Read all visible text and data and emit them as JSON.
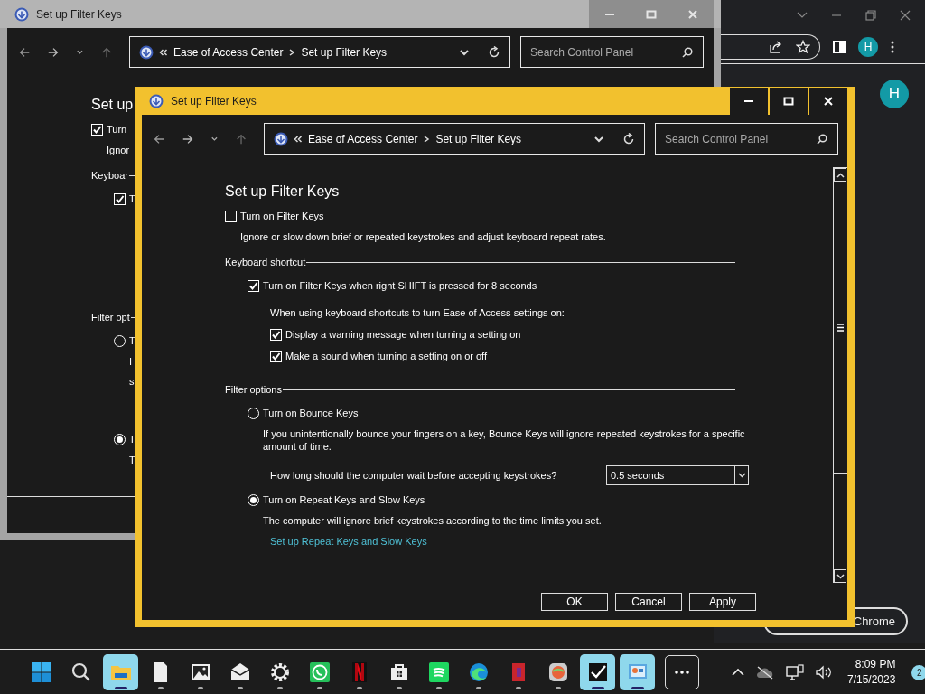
{
  "chrome_window": {
    "profile_initial": "H",
    "account_initial": "H",
    "open_button": "Chrome"
  },
  "back_window": {
    "title": "Set up Filter Keys",
    "breadcrumb": [
      "Ease of Access Center",
      "Set up Filter Keys"
    ],
    "search": {
      "placeholder": "Search Control Panel"
    },
    "content": [
      {
        "kind": "heading",
        "text": "Set up"
      },
      {
        "kind": "checkbox",
        "text": "Turn",
        "checked": true,
        "children": [
          {
            "kind": "description",
            "text": "Ignor"
          }
        ]
      },
      {
        "kind": "group",
        "text": "Keyboar",
        "children": [
          {
            "kind": "checkbox",
            "text": "T",
            "checked": true
          }
        ]
      },
      {
        "kind": "group",
        "text": "Filter opt",
        "children": [
          {
            "kind": "radio",
            "text": "T",
            "selected": false,
            "children": [
              {
                "kind": "description",
                "text": "I"
              },
              {
                "kind": "description",
                "text": "s"
              }
            ]
          },
          {
            "kind": "radio",
            "text": "T",
            "selected": true,
            "children": [
              {
                "kind": "description",
                "text": "T"
              }
            ]
          }
        ]
      }
    ]
  },
  "dialog": {
    "title": "Set up Filter Keys",
    "breadcrumb": [
      "Ease of Access Center",
      "Set up Filter Keys"
    ],
    "search": {
      "placeholder": "Search Control Panel"
    },
    "content": [
      {
        "kind": "heading",
        "text": "Set up Filter Keys"
      },
      {
        "kind": "checkbox",
        "text": "Turn on Filter Keys",
        "checked": false,
        "children": [
          {
            "kind": "description",
            "text": "Ignore or slow down brief or repeated keystrokes and adjust keyboard repeat rates."
          }
        ]
      },
      {
        "kind": "group",
        "text": "Keyboard shortcut",
        "children": [
          {
            "kind": "checkbox",
            "text": "Turn on Filter Keys when right SHIFT is pressed for 8 seconds",
            "checked": true,
            "children": [
              {
                "kind": "text",
                "text": "When using keyboard shortcuts to turn Ease of Access settings on:"
              },
              {
                "kind": "checkbox",
                "text": "Display a warning message when turning a setting on",
                "checked": true
              },
              {
                "kind": "checkbox",
                "text": "Make a sound when turning a setting on or off",
                "checked": true
              }
            ]
          }
        ]
      },
      {
        "kind": "group",
        "text": "Filter options",
        "children": [
          {
            "kind": "radio",
            "text": "Turn on Bounce Keys",
            "selected": false,
            "children": [
              {
                "kind": "description",
                "text": "If you unintentionally bounce your fingers on a key, Bounce Keys will ignore repeated keystrokes for a specific amount of time."
              },
              {
                "kind": "select",
                "label": "How long should the computer wait before accepting keystrokes?",
                "value": "0.5 seconds"
              }
            ]
          },
          {
            "kind": "radio",
            "text": "Turn on Repeat Keys and Slow Keys",
            "selected": true,
            "children": [
              {
                "kind": "description",
                "text": "The computer will ignore brief keystrokes according to the time limits you set."
              },
              {
                "kind": "link",
                "text": "Set up Repeat Keys and Slow Keys"
              }
            ]
          }
        ]
      }
    ],
    "buttons": [
      "OK",
      "Cancel",
      "Apply"
    ]
  },
  "taskbar": {
    "apps": [
      {
        "selected": true,
        "running": true
      },
      {
        "selected": false,
        "running": true
      },
      {
        "selected": false,
        "running": true
      },
      {
        "selected": false,
        "running": true
      },
      {
        "selected": false,
        "running": true
      },
      {
        "selected": false,
        "running": true
      },
      {
        "selected": false,
        "running": true
      },
      {
        "selected": false,
        "running": true
      },
      {
        "selected": false,
        "running": true
      },
      {
        "selected": false,
        "running": true
      },
      {
        "selected": false,
        "running": true
      },
      {
        "selected": false,
        "running": true
      },
      {
        "selected": true,
        "running": true
      },
      {
        "selected": true,
        "running": true
      }
    ],
    "clock": {
      "time": "8:09 PM",
      "date": "7/15/2023"
    },
    "notification_count": "2"
  }
}
